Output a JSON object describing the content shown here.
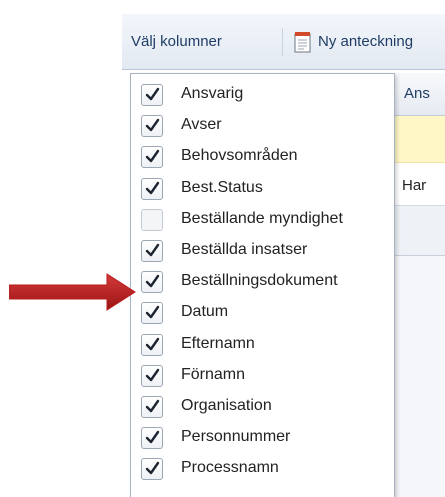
{
  "toolbar": {
    "choose_columns_label": "Välj kolumner",
    "new_note_label": "Ny anteckning"
  },
  "grid": {
    "header_partial": "Ans",
    "row_partial_text": "Har"
  },
  "column_menu": {
    "items": [
      {
        "label": "Ansvarig",
        "checked": true
      },
      {
        "label": "Avser",
        "checked": true
      },
      {
        "label": "Behovsområden",
        "checked": true
      },
      {
        "label": "Best.Status",
        "checked": true
      },
      {
        "label": "Beställande myndighet",
        "checked": false
      },
      {
        "label": "Beställda insatser",
        "checked": true
      },
      {
        "label": "Beställningsdokument",
        "checked": true
      },
      {
        "label": "Datum",
        "checked": true
      },
      {
        "label": "Efternamn",
        "checked": true
      },
      {
        "label": "Förnamn",
        "checked": true
      },
      {
        "label": "Organisation",
        "checked": true
      },
      {
        "label": "Personnummer",
        "checked": true
      },
      {
        "label": "Processnamn",
        "checked": true
      }
    ]
  },
  "annotation": {
    "arrow_color": "#b81c1c",
    "points_to_item": "Beställningsdokument"
  }
}
